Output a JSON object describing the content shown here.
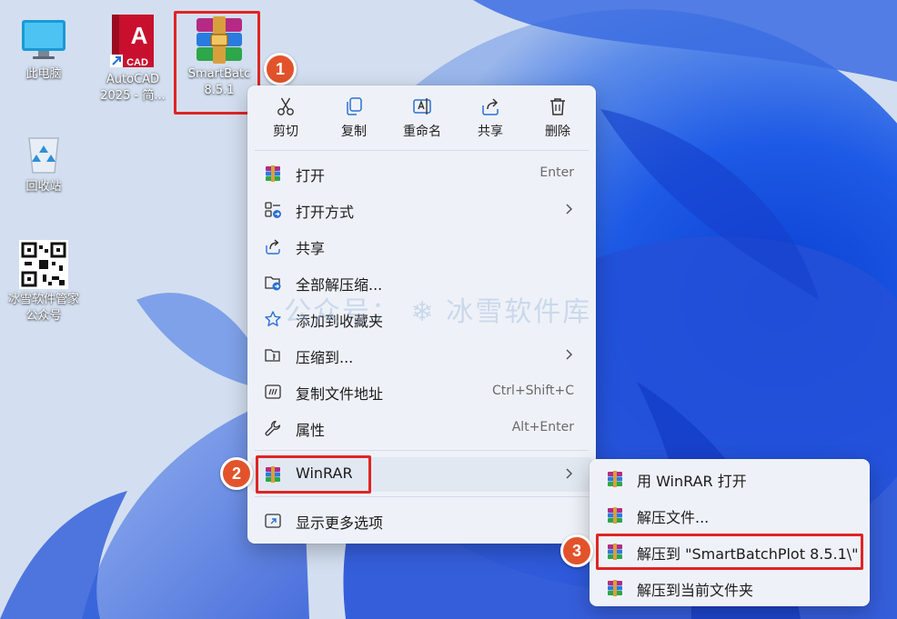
{
  "desktop": {
    "icons": [
      {
        "label_line1": "此电脑",
        "label_line2": ""
      },
      {
        "label_line1": "AutoCAD",
        "label_line2": "2025 - 简..."
      },
      {
        "label_line1": "SmartBatc",
        "label_line2": "8.5.1"
      },
      {
        "label_line1": "回收站",
        "label_line2": ""
      },
      {
        "label_line1": "冰雪软件管家",
        "label_line2": "公众号"
      }
    ],
    "cad_badge": "CAD",
    "cad_letter": "A"
  },
  "watermark": "公众号：  ❄ 冰雪软件库",
  "steps": [
    "1",
    "2",
    "3"
  ],
  "toolbar": [
    {
      "label": "剪切",
      "icon": "scissors-icon"
    },
    {
      "label": "复制",
      "icon": "copy-icon"
    },
    {
      "label": "重命名",
      "icon": "rename-icon"
    },
    {
      "label": "共享",
      "icon": "share-icon"
    },
    {
      "label": "删除",
      "icon": "trash-icon"
    }
  ],
  "menu_items": [
    {
      "label": "打开",
      "shortcut": "Enter",
      "icon": "winrar-icon"
    },
    {
      "label": "打开方式",
      "shortcut": "",
      "icon": "open-with-icon"
    },
    {
      "label": "共享",
      "shortcut": "",
      "icon": "share-icon"
    },
    {
      "label": "全部解压缩...",
      "shortcut": "",
      "icon": "extract-all-icon"
    },
    {
      "label": "添加到收藏夹",
      "shortcut": "",
      "icon": "star-icon"
    },
    {
      "label": "压缩到...",
      "shortcut": "",
      "icon": "compress-icon"
    },
    {
      "label": "复制文件地址",
      "shortcut": "Ctrl+Shift+C",
      "icon": "copy-path-icon"
    },
    {
      "label": "属性",
      "shortcut": "Alt+Enter",
      "icon": "wrench-icon"
    },
    {
      "label": "WinRAR",
      "shortcut": "",
      "icon": "winrar-icon"
    },
    {
      "label": "显示更多选项",
      "shortcut": "",
      "icon": "more-options-icon"
    }
  ],
  "submenu_items": [
    {
      "label": "用 WinRAR 打开"
    },
    {
      "label": "解压文件..."
    },
    {
      "label": "解压到 \"SmartBatchPlot 8.5.1\\\""
    },
    {
      "label": "解压到当前文件夹"
    }
  ],
  "colors": {
    "accent_red": "#e02424",
    "badge": "#e2532b",
    "menu_bg": "#eef2f8"
  }
}
